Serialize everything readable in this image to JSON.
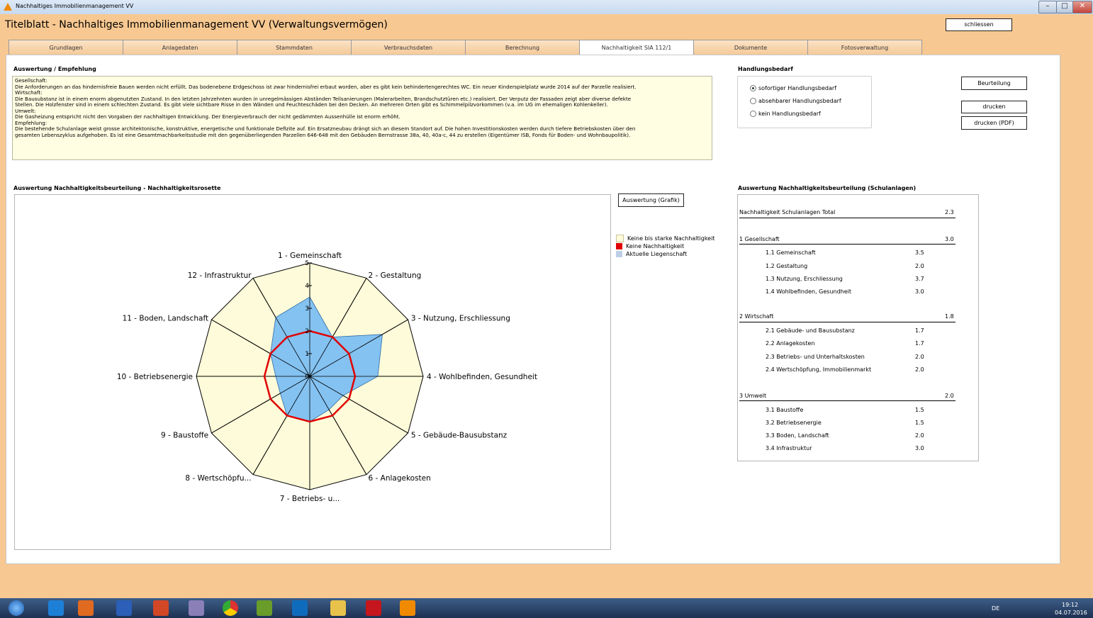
{
  "window": {
    "title": "Nachhaltiges Immobilienmanagement VV",
    "minimize": "–",
    "maximize": "□",
    "close": "✕"
  },
  "header": {
    "title": "Titelblatt - Nachhaltiges Immobilienmanagement VV (Verwaltungsvermögen)",
    "close_button": "schliessen"
  },
  "tabs": [
    "Grundlagen",
    "Anlagedaten",
    "Stammdaten",
    "Verbrauchsdaten",
    "Berechnung",
    "Nachhaltigkeit SIA 112/1",
    "Dokumente",
    "Fotosverwaltung"
  ],
  "active_tab": 5,
  "evaluation": {
    "title": "Auswertung / Empfehlung",
    "lines": [
      "Gesellschaft:",
      "Die Anforderungen an das hindernisfreie Bauen werden nicht erfüllt. Das bodenebene Erdgeschoss ist zwar hindernisfrei erbaut worden, aber es gibt kein behindertengerechtes WC. Ein neuer Kinderspielplatz wurde 2014 auf der Parzelle realisiert.",
      "Wirtschaft:",
      "Die Bausubstanz ist in einem enorm abgenutzten Zustand. In den letzten Jahrzehnten wurden in unregelmässigen Abständen Teilsanierungen (Malerarbeiten, Brandschutztüren etc.) realisiert. Der Verputz der Fassaden zeigt aber diverse defekte",
      "Stellen. Die Holzfenster sind in einem schlechten Zustand. Es gibt viele sichtbare Risse in den Wänden und Feuchteschäden bei den Decken. An mehreren Orten gibt es Schimmelpilzvorkommen (v.a. im UG im ehemaligen Kohlenkeller).",
      "Umwelt:",
      "Die Gasheizung entspricht nicht den Vorgaben der nachhaltigen Entwicklung. Der Energieverbrauch der nicht gedämmten Aussenhülle ist enorm erhöht.",
      "Empfehlung:",
      "Die bestehende Schulanlage weist grosse architektonische, konstruktive, energetische und funktionale Defizite auf. Ein Ersatzneubau drängt sich an diesem Standort auf. Die hohen Investitionskosten werden durch tiefere Betriebskosten über den",
      "gesamten Lebenszyklus aufgehoben. Es ist eine Gesamtmachbarkeitsstudie mit den gegenüberliegenden Parzellen 646-648 mit den Gebäuden Bernstrasse 38a, 40, 40a-c, 44 zu erstellen (Eigentümer ISB, Fonds für Boden- und Wohnbaupolitik)."
    ]
  },
  "handlung": {
    "title": "Handlungsbedarf",
    "options": [
      "sofortiger Handlungsbedarf",
      "absehbarer Handlungsbedarf",
      "kein Handlungsbedarf"
    ],
    "selected": 0,
    "buttons": {
      "beurteilung": "Beurteilung",
      "drucken": "drucken",
      "drucken_pdf": "drucken (PDF)"
    }
  },
  "rosette": {
    "title": "Auswertung Nachhaltigkeitsbeurteilung - Nachhaltigkeitsrosette",
    "grafik_button": "Auswertung (Grafik)"
  },
  "legend": [
    {
      "label": "Keine bis starke Nachhaltigkeit",
      "color": "#fdfbd9"
    },
    {
      "label": "Keine Nachhaltigkeit",
      "color": "#e00000"
    },
    {
      "label": "Aktuelle Liegenschaft",
      "color": "#bccfe5"
    }
  ],
  "chart_data": {
    "type": "radar",
    "axes": [
      "1 - Gemeinschaft",
      "2 - Gestaltung",
      "3 - Nutzung, Erschliessung",
      "4 - Wohlbefinden, Gesundheit",
      "5 - Gebäude-Bausubstanz",
      "6 - Anlagekosten",
      "7 - Betriebs- u...",
      "8 - Wertschöpfu...",
      "9 - Baustoffe",
      "10 - Betriebsenergie",
      "11 - Boden, Landschaft",
      "12 - Infrastruktur"
    ],
    "rmin": 0,
    "rmax": 5,
    "ticks": [
      "0",
      "1",
      "2",
      "3",
      "4",
      "5"
    ],
    "series": [
      {
        "name": "Keine bis starke Nachhaltigkeit",
        "values": [
          5,
          5,
          5,
          5,
          5,
          5,
          5,
          5,
          5,
          5,
          5,
          5
        ],
        "color": "#fdfbd9"
      },
      {
        "name": "Aktuelle Liegenschaft",
        "values": [
          3.5,
          2.0,
          3.7,
          3.0,
          1.7,
          1.7,
          2.0,
          2.0,
          1.5,
          1.5,
          2.0,
          3.0
        ],
        "color": "#7dbff2"
      },
      {
        "name": "Keine Nachhaltigkeit",
        "values": [
          2,
          2,
          2,
          2,
          2,
          2,
          2,
          2,
          2,
          2,
          2,
          2
        ],
        "color": "#e00000"
      }
    ]
  },
  "summary": {
    "title": "Auswertung Nachhaltigkeitsbeurteilung (Schulanlagen)",
    "total": {
      "label": "Nachhaltigkeit Schulanlagen Total",
      "value": "2.3"
    },
    "groups": [
      {
        "label": "1 Gesellschaft",
        "value": "3.0",
        "items": [
          {
            "label": "1.1 Gemeinschaft",
            "value": "3.5"
          },
          {
            "label": "1.2 Gestaltung",
            "value": "2.0"
          },
          {
            "label": "1.3 Nutzung, Erschliessung",
            "value": "3.7"
          },
          {
            "label": "1.4 Wohlbefinden, Gesundheit",
            "value": "3.0"
          }
        ]
      },
      {
        "label": "2 Wirtschaft",
        "value": "1.8",
        "items": [
          {
            "label": "2.1 Gebäude- und Bausubstanz",
            "value": "1.7"
          },
          {
            "label": "2.2 Anlagekosten",
            "value": "1.7"
          },
          {
            "label": "2.3 Betriebs- und Unterhaltskosten",
            "value": "2.0"
          },
          {
            "label": "2.4 Wertschöpfung, Immobilienmarkt",
            "value": "2.0"
          }
        ]
      },
      {
        "label": "3 Umwelt",
        "value": "2.0",
        "items": [
          {
            "label": "3.1 Baustoffe",
            "value": "1.5"
          },
          {
            "label": "3.2 Betriebsenergie",
            "value": "1.5"
          },
          {
            "label": "3.3 Boden, Landschaft",
            "value": "2.0"
          },
          {
            "label": "3.4 Infrastruktur",
            "value": "3.0"
          }
        ]
      }
    ]
  },
  "taskbar": {
    "lang": "DE",
    "time": "19:12",
    "date": "04.07.2016"
  }
}
